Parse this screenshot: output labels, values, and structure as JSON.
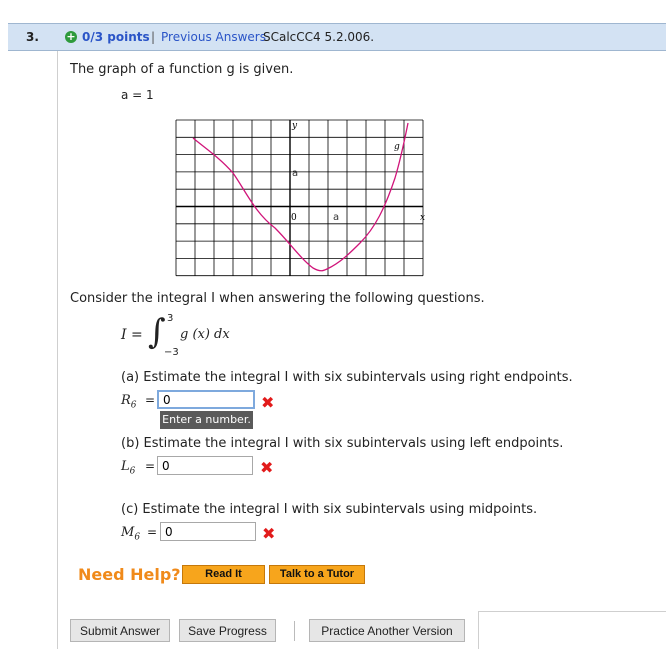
{
  "header": {
    "number": "3.",
    "plus": "+",
    "points": "0/3 points",
    "separator": "|",
    "previous": "Previous Answers",
    "source": "SCalcCC4 5.2.006."
  },
  "problem": {
    "intro": "The graph of a function g is given.",
    "a_value": "a = 1",
    "graph_labels": {
      "y": "y",
      "g": "g",
      "a_up": "a",
      "zero": "0",
      "a_right": "a",
      "x": "x"
    },
    "consider": "Consider the integral I when answering the following questions.",
    "integral": {
      "lhs": "I =",
      "upper": "3",
      "lower": "−3",
      "integrand": "g (x) dx"
    }
  },
  "parts": [
    {
      "text": "(a) Estimate the integral I with six subintervals using right endpoints.",
      "label": "R",
      "sub": "6",
      "value": "0"
    },
    {
      "text": "(b) Estimate the integral I with six subintervals using left endpoints.",
      "label": "L",
      "sub": "6",
      "value": "0"
    },
    {
      "text": "(c) Estimate the integral I with six subintervals using midpoints.",
      "label": "M",
      "sub": "6",
      "value": "0"
    }
  ],
  "equals": "=",
  "wrong_mark": "✖",
  "tooltip": "Enter a number.",
  "help": {
    "label": "Need Help?",
    "read": "Read It",
    "tutor": "Talk to a Tutor"
  },
  "buttons": {
    "submit": "Submit Answer",
    "save": "Save Progress",
    "practice": "Practice Another Version"
  },
  "colors": {
    "curve": "#d0157a",
    "header_bg": "#d3e2f3",
    "link": "#2a54c7",
    "help": "#f08a1a"
  }
}
